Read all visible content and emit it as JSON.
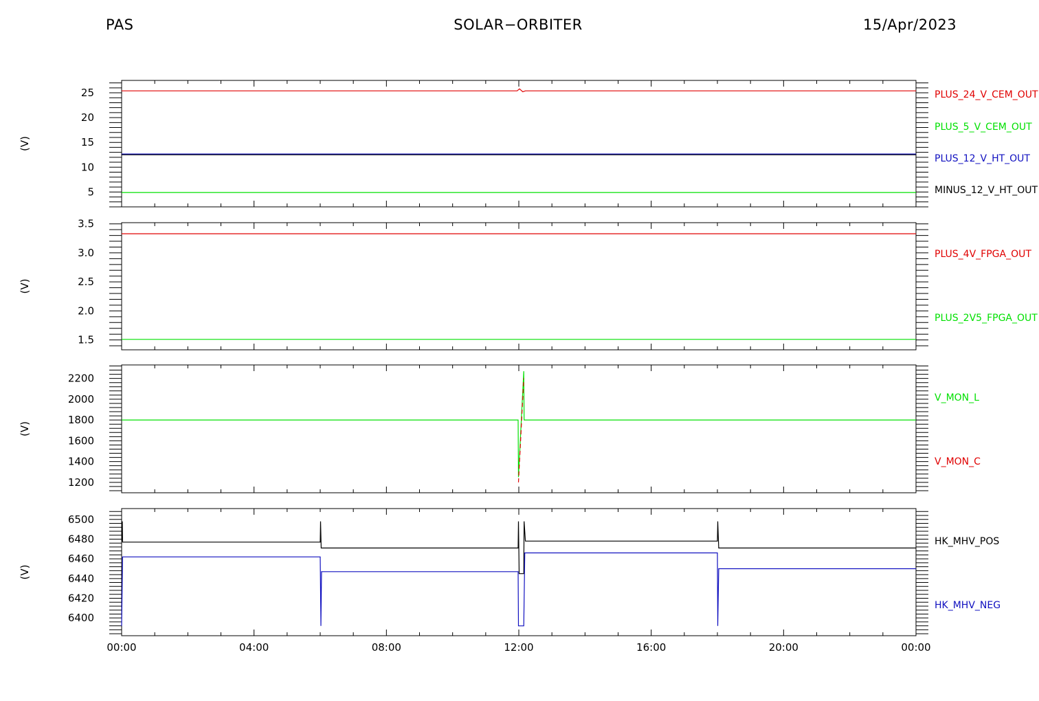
{
  "header": {
    "left": "PAS",
    "center": "SOLAR−ORBITER",
    "right": "15/Apr/2023"
  },
  "chart_data": [
    {
      "type": "line",
      "ylabel": "(V)",
      "ylim": [
        2,
        27.5
      ],
      "yticks": [
        5,
        10,
        15,
        20,
        25
      ],
      "ytick_labels": [
        "5",
        "10",
        "15",
        "20",
        "25"
      ],
      "x_hours": [
        0,
        4,
        8,
        12,
        16,
        20,
        24
      ],
      "xtick_labels": [
        "00:00",
        "04:00",
        "08:00",
        "12:00",
        "16:00",
        "20:00",
        "00:00"
      ],
      "series": [
        {
          "name": "PLUS_24_V_CEM_OUT",
          "color": "#e00000",
          "points": [
            [
              0,
              25.4
            ],
            [
              11.95,
              25.4
            ],
            [
              12.02,
              25.8
            ],
            [
              12.12,
              25.2
            ],
            [
              12.2,
              25.4
            ],
            [
              24,
              25.4
            ]
          ]
        },
        {
          "name": "PLUS_5_V_CEM_OUT",
          "color": "#00e000",
          "points": [
            [
              0,
              4.9
            ],
            [
              24,
              4.9
            ]
          ]
        },
        {
          "name": "PLUS_12_V_HT_OUT",
          "color": "#1010c0",
          "points": [
            [
              0,
              12.6
            ],
            [
              24,
              12.6
            ]
          ]
        },
        {
          "name": "MINUS_12_V_HT_OUT",
          "color": "#000000",
          "points": [
            [
              0,
              12.5
            ],
            [
              24,
              12.5
            ]
          ]
        }
      ]
    },
    {
      "type": "line",
      "ylabel": "(V)",
      "ylim": [
        1.33,
        3.52
      ],
      "yticks": [
        1.5,
        2.0,
        2.5,
        3.0,
        3.5
      ],
      "ytick_labels": [
        "1.5",
        "2.0",
        "2.5",
        "3.0",
        "3.5"
      ],
      "x_hours": [
        0,
        4,
        8,
        12,
        16,
        20,
        24
      ],
      "xtick_labels": [
        "00:00",
        "04:00",
        "08:00",
        "12:00",
        "16:00",
        "20:00",
        "00:00"
      ],
      "series": [
        {
          "name": "PLUS_4V_FPGA_OUT",
          "color": "#e00000",
          "points": [
            [
              0,
              3.33
            ],
            [
              24,
              3.33
            ]
          ]
        },
        {
          "name": "PLUS_2V5_FPGA_OUT",
          "color": "#00e000",
          "points": [
            [
              0,
              1.51
            ],
            [
              24,
              1.51
            ]
          ]
        }
      ]
    },
    {
      "type": "line",
      "ylabel": "(V)",
      "ylim": [
        1100,
        2330
      ],
      "yticks": [
        1200,
        1400,
        1600,
        1800,
        2000,
        2200
      ],
      "ytick_labels": [
        "1200",
        "1400",
        "1600",
        "1800",
        "2000",
        "2200"
      ],
      "x_hours": [
        0,
        4,
        8,
        12,
        16,
        20,
        24
      ],
      "xtick_labels": [
        "00:00",
        "04:00",
        "08:00",
        "12:00",
        "16:00",
        "20:00",
        "00:00"
      ],
      "series": [
        {
          "name": "V_MON_L",
          "color": "#00e000",
          "points": [
            [
              0,
              1800
            ],
            [
              11.98,
              1800
            ],
            [
              11.99,
              1250
            ],
            [
              12.15,
              2270
            ],
            [
              12.16,
              1800
            ],
            [
              24,
              1800
            ]
          ]
        },
        {
          "name": "V_MON_C",
          "color": "#e00000",
          "points": [
            [
              11.99,
              1200
            ],
            [
              12.15,
              2200
            ]
          ],
          "dashed": true
        }
      ]
    },
    {
      "type": "line",
      "ylabel": "(V)",
      "ylim": [
        6382,
        6511
      ],
      "yticks": [
        6400,
        6420,
        6440,
        6460,
        6480,
        6500
      ],
      "ytick_labels": [
        "6400",
        "6420",
        "6440",
        "6460",
        "6480",
        "6500"
      ],
      "x_hours": [
        0,
        4,
        8,
        12,
        16,
        20,
        24
      ],
      "xtick_labels": [
        "00:00",
        "04:00",
        "08:00",
        "12:00",
        "16:00",
        "20:00",
        "00:00"
      ],
      "series": [
        {
          "name": "HK_MHV_POS",
          "color": "#000000",
          "points": [
            [
              0,
              6478
            ],
            [
              0.02,
              6498
            ],
            [
              0.03,
              6477
            ],
            [
              6.0,
              6477
            ],
            [
              6.01,
              6498
            ],
            [
              6.03,
              6471
            ],
            [
              11.98,
              6471
            ],
            [
              11.99,
              6498
            ],
            [
              12.01,
              6445
            ],
            [
              12.15,
              6445
            ],
            [
              12.16,
              6498
            ],
            [
              12.2,
              6478
            ],
            [
              18.0,
              6478
            ],
            [
              18.01,
              6498
            ],
            [
              18.04,
              6471
            ],
            [
              24,
              6471
            ]
          ]
        },
        {
          "name": "HK_MHV_NEG",
          "color": "#1010c0",
          "points": [
            [
              0,
              6392
            ],
            [
              0.03,
              6462
            ],
            [
              6.0,
              6462
            ],
            [
              6.02,
              6392
            ],
            [
              6.04,
              6447
            ],
            [
              11.98,
              6447
            ],
            [
              11.99,
              6392
            ],
            [
              12.15,
              6392
            ],
            [
              12.18,
              6466
            ],
            [
              18.0,
              6466
            ],
            [
              18.01,
              6392
            ],
            [
              18.04,
              6450
            ],
            [
              24,
              6450
            ]
          ]
        }
      ]
    }
  ]
}
